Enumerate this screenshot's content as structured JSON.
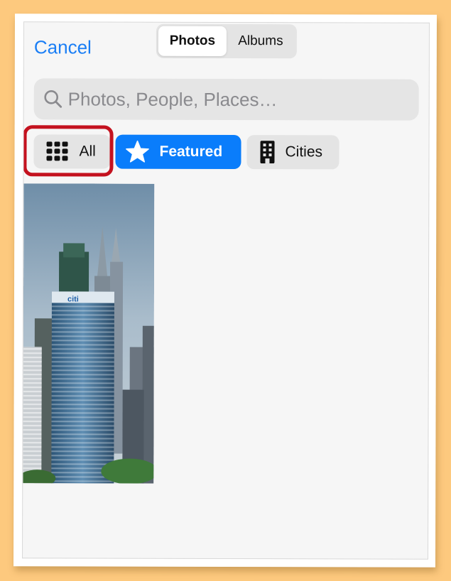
{
  "picker": {
    "cancel_label": "Cancel",
    "tabs": [
      {
        "label": "Photos",
        "active": true
      },
      {
        "label": "Albums",
        "active": false
      }
    ],
    "search": {
      "placeholder": "Photos, People, Places…",
      "value": "",
      "icon": "search-icon"
    },
    "filters": [
      {
        "label": "All",
        "icon": "grid-icon",
        "selected": false,
        "highlighted": true
      },
      {
        "label": "Featured",
        "icon": "star-icon",
        "selected": true
      },
      {
        "label": "Cities",
        "icon": "building-icon",
        "selected": false
      }
    ],
    "photos": [
      {
        "subject": "city-skyline-photo"
      }
    ]
  },
  "colors": {
    "accent": "#0a7dfb",
    "link": "#1a7ef5",
    "highlight_border": "#c4121f",
    "page_background": "#fdc97e"
  }
}
